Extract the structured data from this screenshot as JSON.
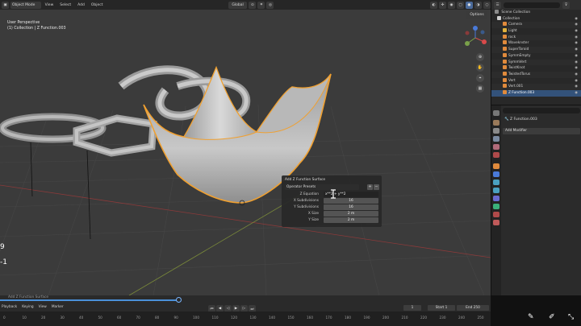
{
  "header": {
    "mode": "Object Mode",
    "menus": [
      "View",
      "Select",
      "Add",
      "Object"
    ],
    "transform": "Global",
    "options": "Options"
  },
  "viewport": {
    "view_name": "User Perspective",
    "collection_info": "(1) Collection | Z Function.003",
    "left_numbers": [
      "9",
      "-1"
    ]
  },
  "operator": {
    "title": "Add Z Function Surface",
    "presets": "Operator Presets",
    "rows": [
      {
        "label": "Z Equation",
        "value": "x**2 + y**2",
        "is_text": true
      },
      {
        "label": "X Subdivisions",
        "value": "16"
      },
      {
        "label": "Y Subdivisions",
        "value": "16"
      },
      {
        "label": "X Size",
        "value": "2 m"
      },
      {
        "label": "Y Size",
        "value": "2 m"
      }
    ]
  },
  "outliner": {
    "title": "Scene Collection",
    "items": [
      {
        "label": "Collection",
        "color": "#cfcfcf",
        "depth": 1
      },
      {
        "label": "Camera",
        "color": "#e08a3c",
        "depth": 2
      },
      {
        "label": "Light",
        "color": "#e0b13c",
        "depth": 2
      },
      {
        "label": "rock",
        "color": "#e08a3c",
        "depth": 2
      },
      {
        "label": "Waveknster",
        "color": "#e08a3c",
        "depth": 2
      },
      {
        "label": "SuperToroid",
        "color": "#e08a3c",
        "depth": 2
      },
      {
        "label": "SymmEmpty",
        "color": "#e08a3c",
        "depth": 2
      },
      {
        "label": "SymmVert",
        "color": "#e08a3c",
        "depth": 2
      },
      {
        "label": "TwistKnot",
        "color": "#e08a3c",
        "depth": 2
      },
      {
        "label": "TwistedTorus",
        "color": "#e08a3c",
        "depth": 2
      },
      {
        "label": "Vert",
        "color": "#e08a3c",
        "depth": 2
      },
      {
        "label": "Vert.001",
        "color": "#e08a3c",
        "depth": 2
      },
      {
        "label": "Z Function.003",
        "color": "#e08a3c",
        "depth": 2,
        "selected": true
      }
    ]
  },
  "properties": {
    "object_name": "Z Function.003",
    "add_modifier": "Add Modifier"
  },
  "timeline": {
    "menus": [
      "Playback",
      "Keying",
      "View",
      "Marker"
    ],
    "last_op": "Add Z Function Surface",
    "current_frame": "1",
    "start_label": "Start",
    "start": "1",
    "end_label": "End",
    "end": "250",
    "ruler": [
      "0",
      "10",
      "20",
      "30",
      "40",
      "50",
      "60",
      "70",
      "80",
      "90",
      "100",
      "110",
      "120",
      "130",
      "140",
      "150",
      "160",
      "170",
      "180",
      "190",
      "200",
      "210",
      "220",
      "230",
      "240",
      "250"
    ]
  },
  "colors": {
    "accent": "#4a90d9",
    "selected_outline": "#f0a030",
    "viewport_bg": "#3b3b3b"
  }
}
